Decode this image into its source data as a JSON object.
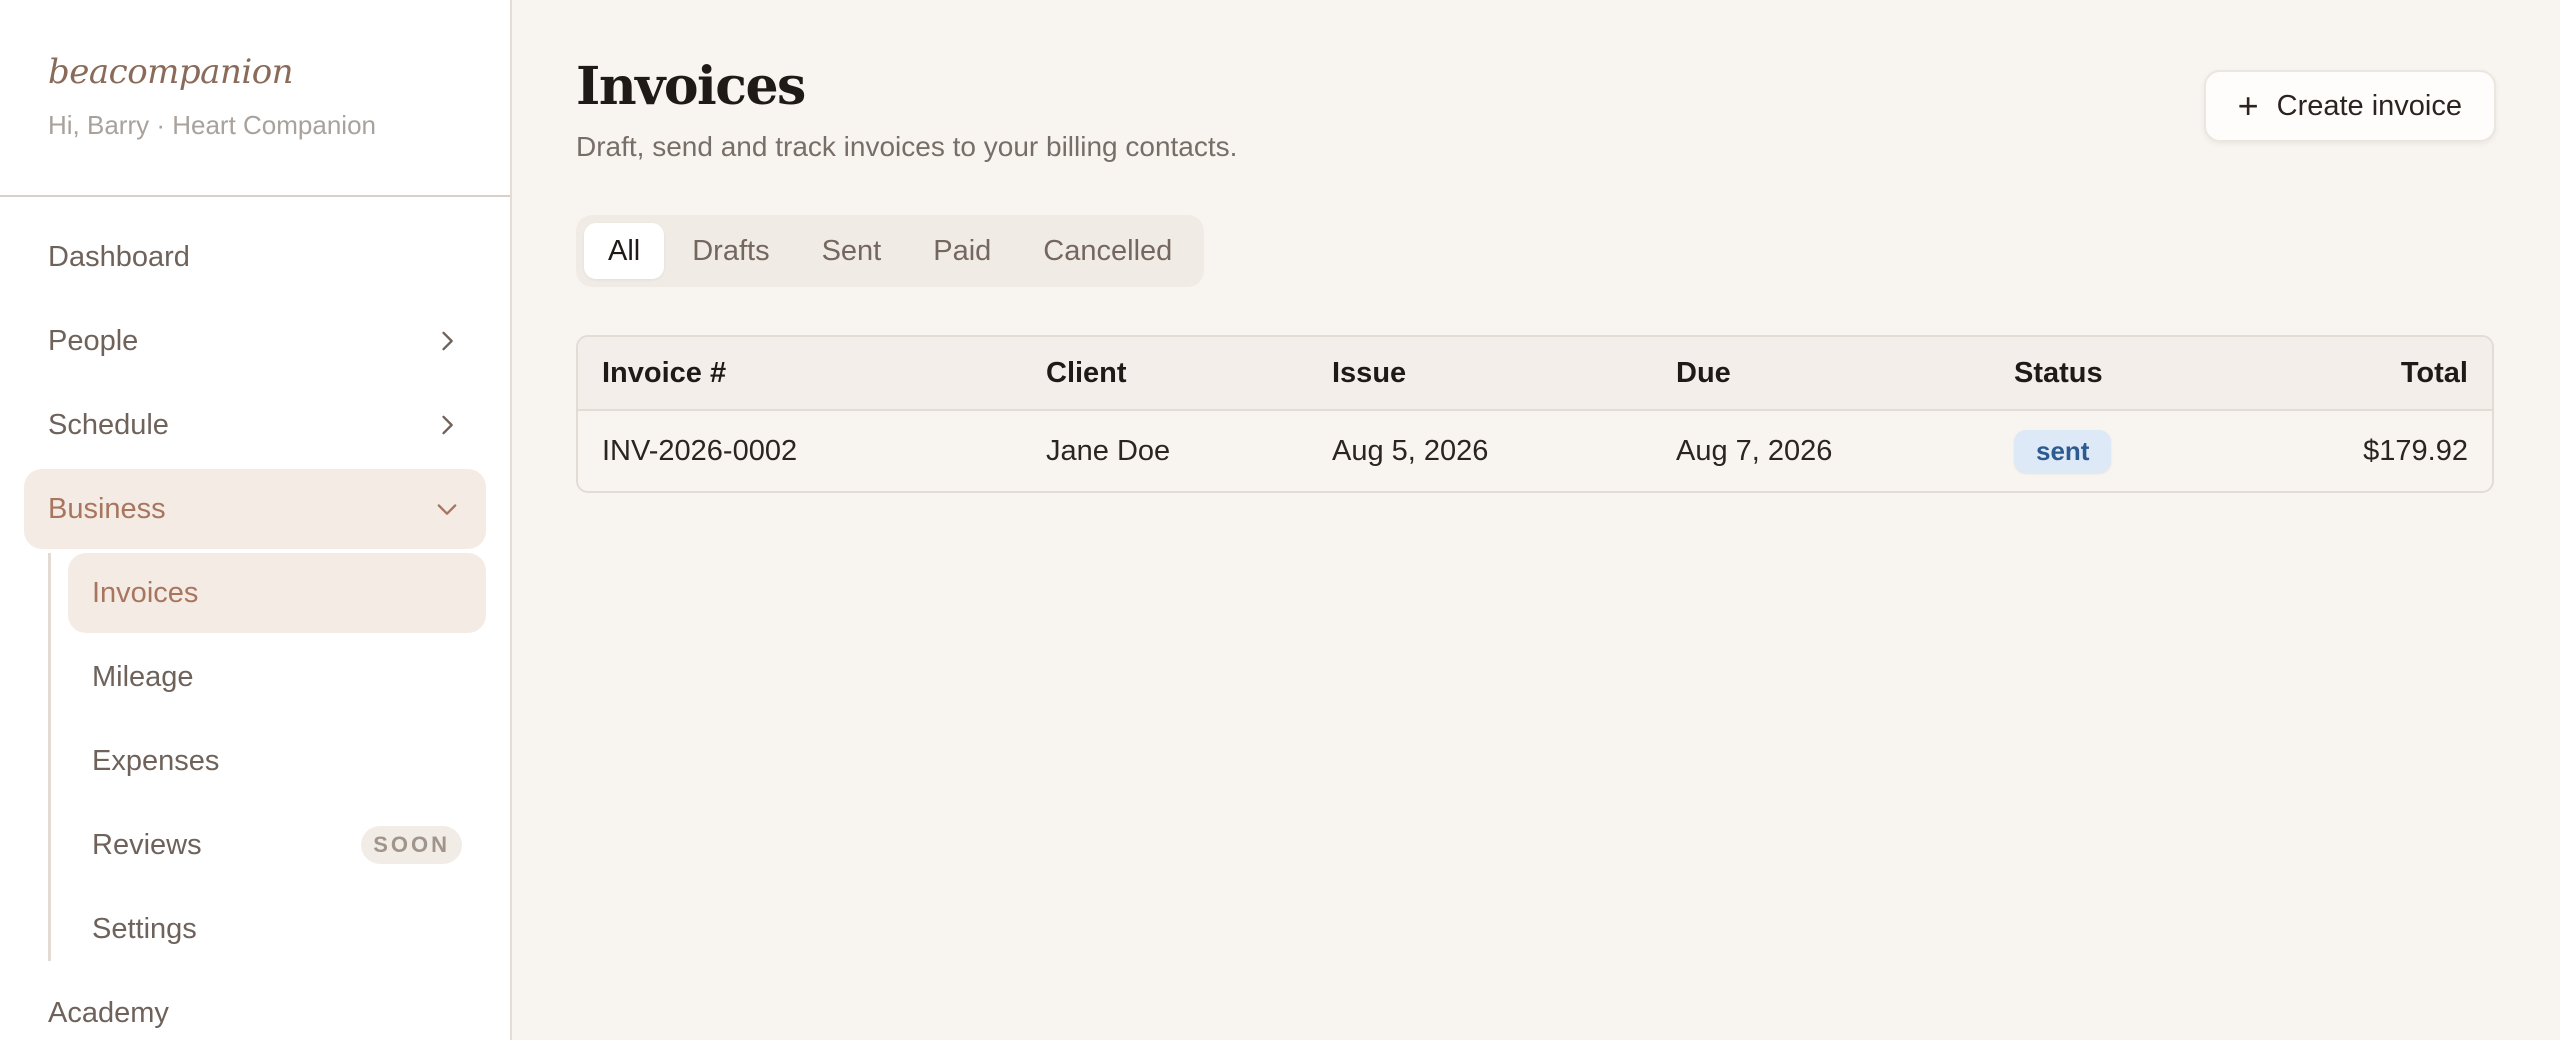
{
  "brand": {
    "name": "beacompanion",
    "greeting": "Hi, Barry · Heart Companion"
  },
  "sidebar": {
    "items": [
      {
        "label": "Dashboard"
      },
      {
        "label": "People"
      },
      {
        "label": "Schedule"
      },
      {
        "label": "Business"
      },
      {
        "label": "Academy"
      }
    ],
    "business_sub": [
      {
        "label": "Invoices"
      },
      {
        "label": "Mileage"
      },
      {
        "label": "Expenses"
      },
      {
        "label": "Reviews",
        "badge": "SOON"
      },
      {
        "label": "Settings"
      }
    ]
  },
  "header": {
    "title": "Invoices",
    "subtitle": "Draft, send and track invoices to your billing contacts.",
    "create_label": "Create invoice"
  },
  "tabs": [
    "All",
    "Drafts",
    "Sent",
    "Paid",
    "Cancelled"
  ],
  "table": {
    "columns": [
      "Invoice #",
      "Client",
      "Issue",
      "Due",
      "Status",
      "Total"
    ],
    "rows": [
      {
        "invoice": "INV-2026-0002",
        "client": "Jane Doe",
        "issue": "Aug 5, 2026",
        "due": "Aug 7, 2026",
        "status": "sent",
        "total": "$179.92"
      }
    ]
  },
  "colors": {
    "accent": "#a8765e",
    "status_sent_bg": "#dde9f7",
    "status_sent_text": "#2e5a92"
  }
}
